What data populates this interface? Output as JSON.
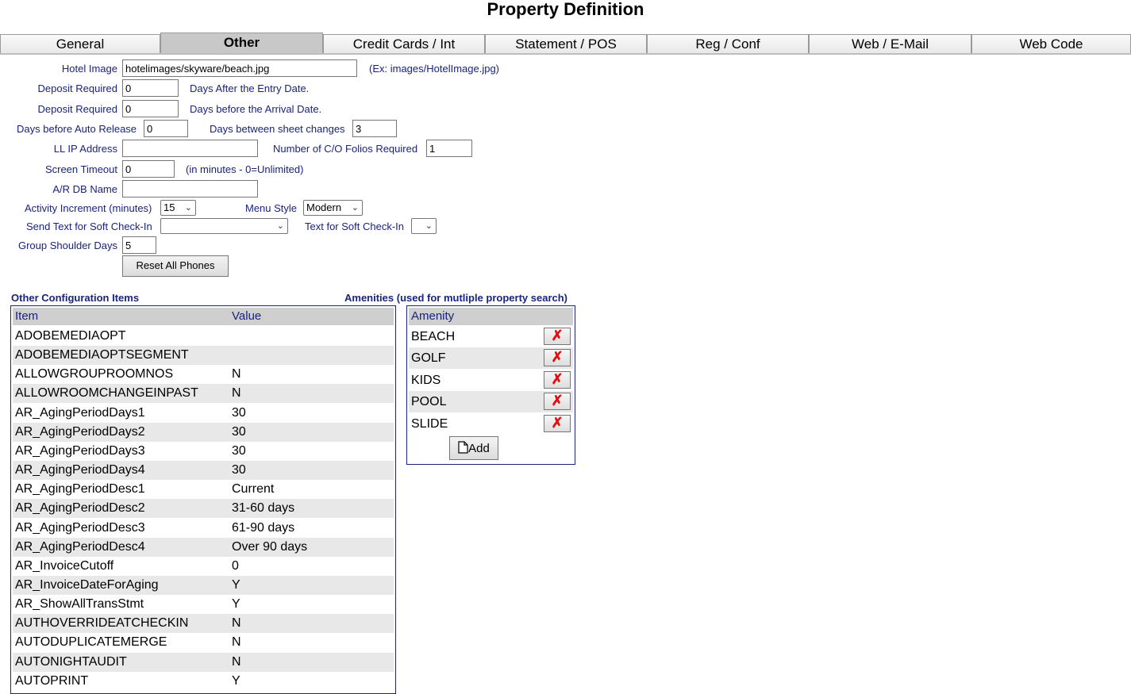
{
  "page": {
    "title": "Property Definition"
  },
  "tabs": [
    {
      "label": "General"
    },
    {
      "label": "Other"
    },
    {
      "label": "Credit Cards / Int"
    },
    {
      "label": "Statement / POS"
    },
    {
      "label": "Reg / Conf"
    },
    {
      "label": "Web / E-Mail"
    },
    {
      "label": "Web Code"
    }
  ],
  "form": {
    "hotel_image_label": "Hotel Image",
    "hotel_image_value": "hotelimages/skyware/beach.jpg",
    "hotel_image_hint": "(Ex: images/HotelImage.jpg)",
    "deposit1_label": "Deposit Required",
    "deposit1_value": "0",
    "deposit1_suffix": "Days After the Entry Date.",
    "deposit2_label": "Deposit Required",
    "deposit2_value": "0",
    "deposit2_suffix": "Days before the Arrival Date.",
    "auto_release_label": "Days before Auto Release",
    "auto_release_value": "0",
    "sheet_changes_label": "Days between sheet changes",
    "sheet_changes_value": "3",
    "ll_ip_label": "LL IP Address",
    "ll_ip_value": "",
    "co_folios_label": "Number of C/O Folios Required",
    "co_folios_value": "1",
    "screen_timeout_label": "Screen Timeout",
    "screen_timeout_value": "0",
    "screen_timeout_hint": "(in minutes - 0=Unlimited)",
    "ar_db_label": "A/R DB Name",
    "ar_db_value": "",
    "activity_label": "Activity Increment (minutes)",
    "activity_value": "15",
    "menu_style_label": "Menu Style",
    "menu_style_value": "Modern",
    "send_text_label": "Send Text for Soft Check-In",
    "send_text_value": "",
    "text_soft_label": "Text for Soft Check-In",
    "text_soft_value": "",
    "group_shoulder_label": "Group Shoulder Days",
    "group_shoulder_value": "5",
    "reset_phones_label": "Reset All Phones"
  },
  "config": {
    "section_title": "Other Configuration Items",
    "col_item": "Item",
    "col_value": "Value",
    "rows": [
      {
        "item": "ADOBEMEDIAOPT",
        "value": ""
      },
      {
        "item": "ADOBEMEDIAOPTSEGMENT",
        "value": ""
      },
      {
        "item": "ALLOWGROUPROOMNOS",
        "value": "N"
      },
      {
        "item": "ALLOWROOMCHANGEINPAST",
        "value": "N"
      },
      {
        "item": "AR_AgingPeriodDays1",
        "value": "30"
      },
      {
        "item": "AR_AgingPeriodDays2",
        "value": "30"
      },
      {
        "item": "AR_AgingPeriodDays3",
        "value": "30"
      },
      {
        "item": "AR_AgingPeriodDays4",
        "value": "30"
      },
      {
        "item": "AR_AgingPeriodDesc1",
        "value": "Current"
      },
      {
        "item": "AR_AgingPeriodDesc2",
        "value": "31-60 days"
      },
      {
        "item": "AR_AgingPeriodDesc3",
        "value": "61-90 days"
      },
      {
        "item": "AR_AgingPeriodDesc4",
        "value": "Over 90 days"
      },
      {
        "item": "AR_InvoiceCutoff",
        "value": "0"
      },
      {
        "item": "AR_InvoiceDateForAging",
        "value": "Y"
      },
      {
        "item": "AR_ShowAllTransStmt",
        "value": "Y"
      },
      {
        "item": "AUTHOVERRIDEATCHECKIN",
        "value": "N"
      },
      {
        "item": "AUTODUPLICATEMERGE",
        "value": "N"
      },
      {
        "item": "AUTONIGHTAUDIT",
        "value": "N"
      },
      {
        "item": "AUTOPRINT",
        "value": "Y"
      }
    ]
  },
  "amenities": {
    "section_title": "Amenities (used for mutliple property search)",
    "col_amenity": "Amenity",
    "delete_glyph": "✗",
    "rows": [
      {
        "name": "BEACH"
      },
      {
        "name": "GOLF"
      },
      {
        "name": "KIDS"
      },
      {
        "name": "POOL"
      },
      {
        "name": "SLIDE"
      }
    ],
    "add_label": "Add"
  }
}
